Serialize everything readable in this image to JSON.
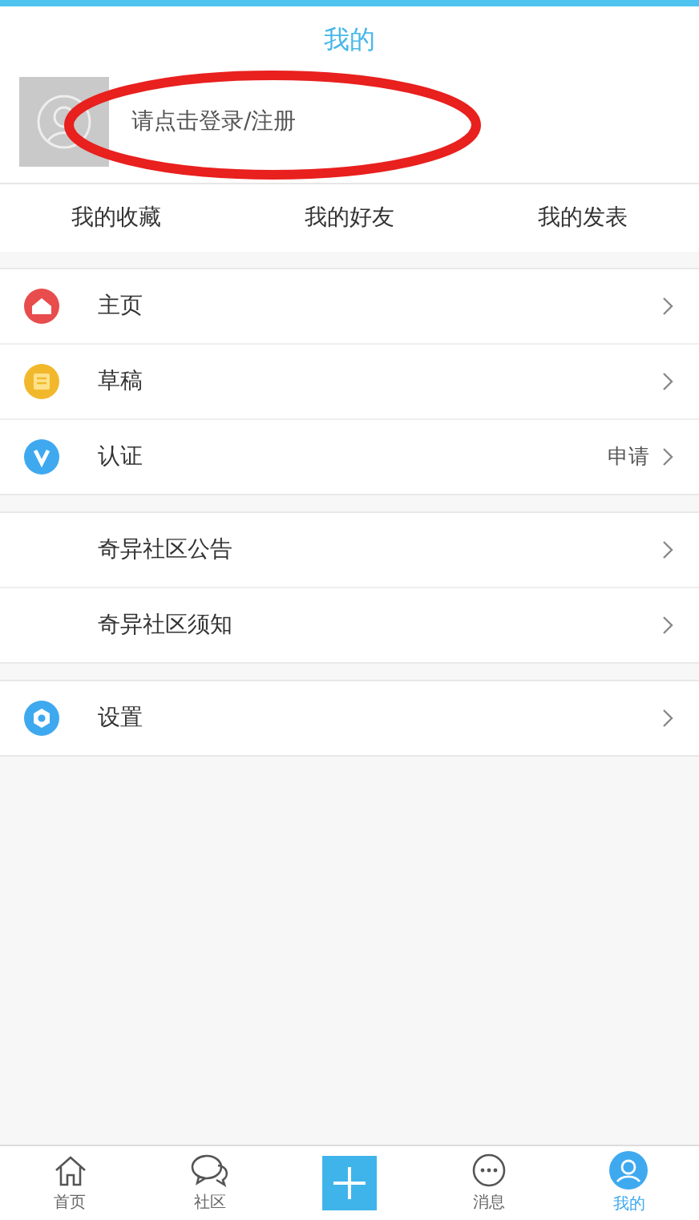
{
  "header": {
    "title": "我的"
  },
  "profile": {
    "login_prompt": "请点击登录/注册"
  },
  "quick_links": [
    "我的收藏",
    "我的好友",
    "我的发表"
  ],
  "menu_groups": [
    [
      {
        "label": "主页",
        "kind": "home",
        "color": "#e84c4c"
      },
      {
        "label": "草稿",
        "kind": "draft",
        "color": "#f2b82c"
      },
      {
        "label": "认证",
        "kind": "verify",
        "color": "#3fa9f0",
        "value": "申请"
      }
    ],
    [
      {
        "label": "奇异社区公告",
        "kind": "plain"
      },
      {
        "label": "奇异社区须知",
        "kind": "plain"
      }
    ],
    [
      {
        "label": "设置",
        "kind": "settings",
        "color": "#3fa9f0"
      }
    ]
  ],
  "tab_bar": [
    {
      "kind": "home",
      "label": "首页",
      "selected": false
    },
    {
      "kind": "community",
      "label": "社区",
      "selected": false
    },
    {
      "kind": "add"
    },
    {
      "kind": "message",
      "label": "消息",
      "selected": false
    },
    {
      "kind": "me",
      "label": "我的",
      "selected": true
    }
  ]
}
